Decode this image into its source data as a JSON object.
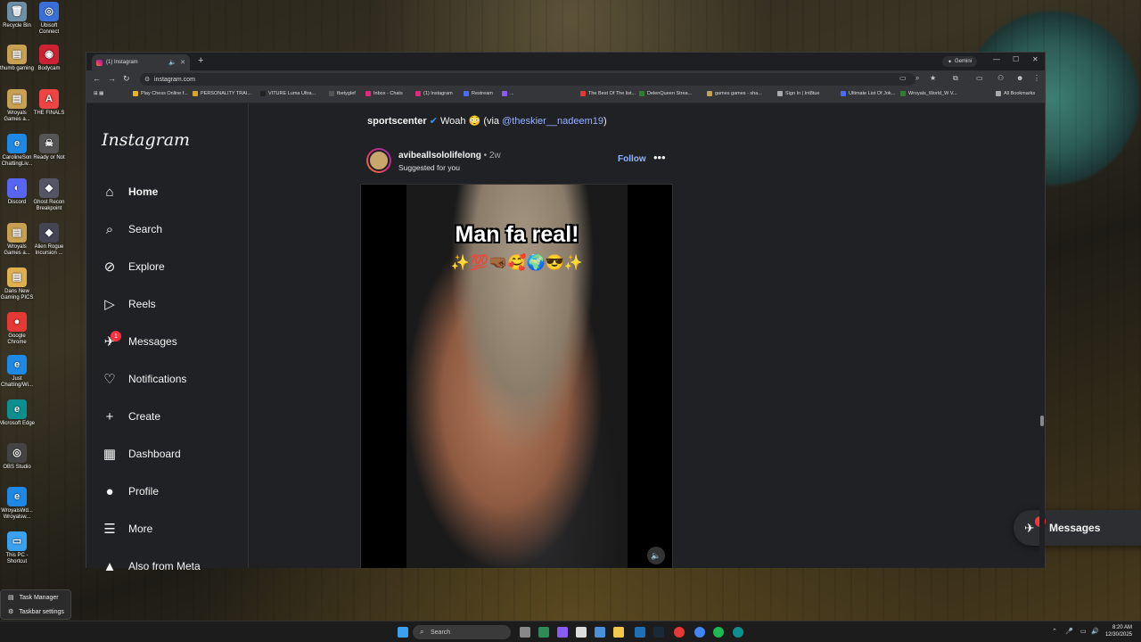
{
  "desktop": {
    "icons": [
      {
        "label": "Recycle Bin",
        "glyph": "🗑"
      },
      {
        "label": "Ubisoft Connect",
        "glyph": "◎"
      },
      {
        "label": "thumb gaming",
        "glyph": "▤"
      },
      {
        "label": "Bodycam",
        "glyph": "◉"
      },
      {
        "label": "Wroyals Games a...",
        "glyph": "▤"
      },
      {
        "label": "THE FINALS",
        "glyph": "A"
      },
      {
        "label": "CarolineSon ChattingLiv...",
        "glyph": "e"
      },
      {
        "label": "Ready or Not",
        "glyph": "☠"
      },
      {
        "label": "Discord",
        "glyph": "◐"
      },
      {
        "label": "Ghost Recon Breakpoint",
        "glyph": "◆"
      },
      {
        "label": "Wroyals Games a...",
        "glyph": "▤"
      },
      {
        "label": "Alien Rogue Incursion ...",
        "glyph": "◆"
      },
      {
        "label": "Dans New Gaming PICS",
        "glyph": "▤"
      },
      {
        "label": "Google Chrome",
        "glyph": "●"
      },
      {
        "label": "Just Chatting/Wi...",
        "glyph": "e"
      },
      {
        "label": "Microsoft Edge",
        "glyph": "e"
      },
      {
        "label": "OBS Studio",
        "glyph": "◎"
      },
      {
        "label": "WroyalsWd... Wroyalsw...",
        "glyph": "e"
      },
      {
        "label": "This PC - Shortcut",
        "glyph": "▭"
      }
    ]
  },
  "browser": {
    "tab_title": "(1) Instagram",
    "gemini_label": "Gemini",
    "url": "instagram.com",
    "bookmarks": [
      "Play Chess Online f...",
      "PERSONALITY TRAI...",
      "VITURE Luma Ultra...",
      "fbetyglef",
      "Inbox - Chats",
      "(1) Instagram",
      "Restream",
      "...",
      "The Best Of The list...",
      "DelenQueen Strea...",
      "games games - sha...",
      "Sign In | Int8tue",
      "Ultimate List Of Jok...",
      "Wroyals_World_W V...",
      "All Bookmarks"
    ]
  },
  "instagram": {
    "logo": "Instagram",
    "nav": [
      {
        "label": "Home",
        "icon": "home-icon",
        "glyph": "⌂"
      },
      {
        "label": "Search",
        "icon": "search-icon",
        "glyph": "⌕"
      },
      {
        "label": "Explore",
        "icon": "compass-icon",
        "glyph": "⊘"
      },
      {
        "label": "Reels",
        "icon": "reels-icon",
        "glyph": "▷"
      },
      {
        "label": "Messages",
        "icon": "messenger-icon",
        "glyph": "✈"
      },
      {
        "label": "Notifications",
        "icon": "heart-icon",
        "glyph": "♡"
      },
      {
        "label": "Create",
        "icon": "plus-icon",
        "glyph": "+"
      },
      {
        "label": "Dashboard",
        "icon": "dashboard-icon",
        "glyph": "▦"
      },
      {
        "label": "Profile",
        "icon": "avatar-icon",
        "glyph": "●"
      },
      {
        "label": "More",
        "icon": "menu-icon",
        "glyph": "☰"
      },
      {
        "label": "Also from Meta",
        "icon": "meta-icon",
        "glyph": "▲"
      }
    ],
    "messages_badge": "1",
    "caption": {
      "user": "sportscenter",
      "text": "Woah 😳 (via ",
      "mention": "@theskier__nadeem19",
      "close": ")"
    },
    "post": {
      "username": "avibeallsololifelong",
      "age": "• 2w",
      "subtitle": "Suggested for you",
      "follow_label": "Follow",
      "more_label": "•••",
      "video_text": "Man fa real!",
      "video_emojis": "✨💯🤜🏾🥰🌍😎✨"
    },
    "messages_bar": {
      "label": "Messages",
      "badge": "1"
    }
  },
  "taskbar": {
    "context_menu": [
      "Task Manager",
      "Taskbar settings"
    ],
    "search_placeholder": "Search",
    "time": "8:20 AM",
    "date": "12/30/2025"
  },
  "colors": {
    "ig_bg": "#202124",
    "accent": "#8fb4ff",
    "badge": "#ff3040"
  }
}
